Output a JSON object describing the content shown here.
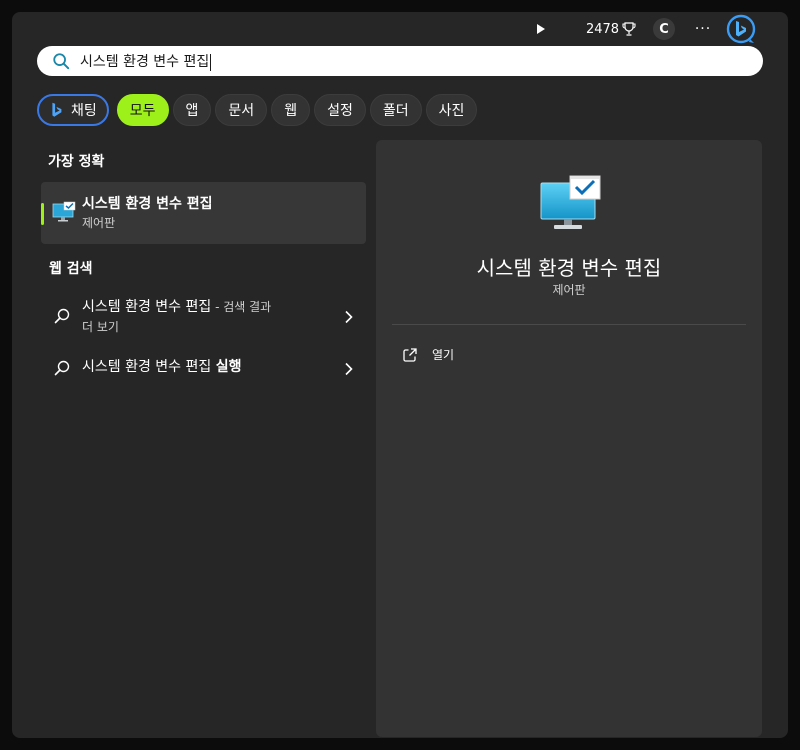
{
  "search": {
    "query": "시스템 환경 변수 편집"
  },
  "filters": {
    "chat_label": "채팅",
    "tabs": [
      "모두",
      "앱",
      "문서",
      "웹",
      "설정",
      "폴더",
      "사진"
    ]
  },
  "toolbar": {
    "points": "2478",
    "profile_initial": "C",
    "more_label": "···"
  },
  "best_match": {
    "section_title": "가장 정확",
    "title": "시스템 환경 변수 편집",
    "subtitle": "제어판"
  },
  "web_search": {
    "section_title": "웹 검색",
    "items": [
      {
        "main": "시스템 환경 변수 편집",
        "muted": " - 검색 결과",
        "line2": "더 보기"
      },
      {
        "main": "시스템 환경 변수 편집 ",
        "bold": "실행"
      }
    ]
  },
  "detail": {
    "title": "시스템 환경 변수 편집",
    "subtitle": "제어판",
    "open_label": "열기"
  },
  "colors": {
    "accent": "#9ef01a",
    "bing_blue": "#3a78e6",
    "pane": "#333333"
  }
}
